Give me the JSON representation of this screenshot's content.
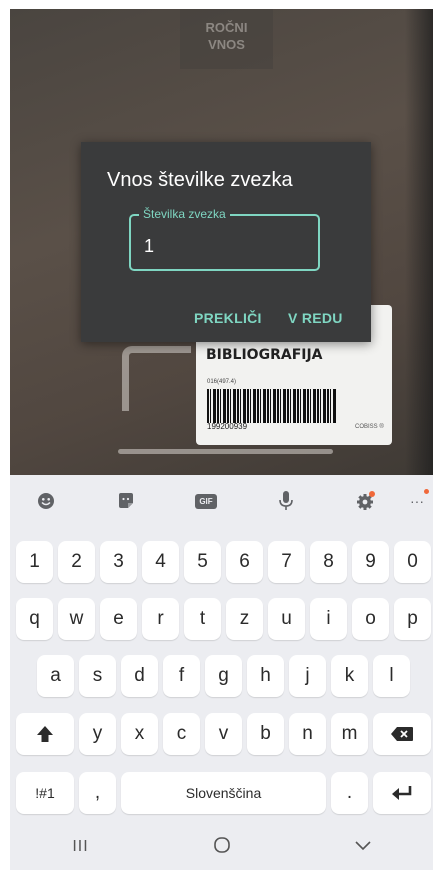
{
  "camera": {
    "manual_button_label": "ROČNI\nVNOS",
    "label_card": {
      "title": "BIBLIOGRAFIJA",
      "small_text": "016(497.4)",
      "barcode_number": "199200939",
      "footer": "COBISS ®"
    }
  },
  "dialog": {
    "title": "Vnos številke zvezka",
    "field_label": "Številka zvezka",
    "field_value": "1",
    "cancel_label": "PREKLIČI",
    "ok_label": "V REDU"
  },
  "keyboard": {
    "toolbar": {
      "gif_label": "GIF",
      "more_label": "···",
      "accent_dot_color": "#f0683a"
    },
    "rows": {
      "numbers": [
        "1",
        "2",
        "3",
        "4",
        "5",
        "6",
        "7",
        "8",
        "9",
        "0"
      ],
      "row1": [
        "q",
        "w",
        "e",
        "r",
        "t",
        "z",
        "u",
        "i",
        "o",
        "p"
      ],
      "row2": [
        "a",
        "s",
        "d",
        "f",
        "g",
        "h",
        "j",
        "k",
        "l"
      ],
      "row3": [
        "y",
        "x",
        "c",
        "v",
        "b",
        "n",
        "m"
      ]
    },
    "symbols_label": "!#1",
    "comma_label": ",",
    "space_label": "Slovenščina",
    "period_label": ".",
    "shift_icon": "shift-arrow",
    "backspace_icon": "backspace",
    "enter_icon": "enter-arrow"
  },
  "navbar": {
    "recent_label": "III",
    "home_icon": "home-circle",
    "back_icon": "chevron-down"
  },
  "colors": {
    "accent": "#7fd6c2",
    "dialog_bg": "#3a3b3c",
    "keyboard_bg": "#ecedf1"
  }
}
